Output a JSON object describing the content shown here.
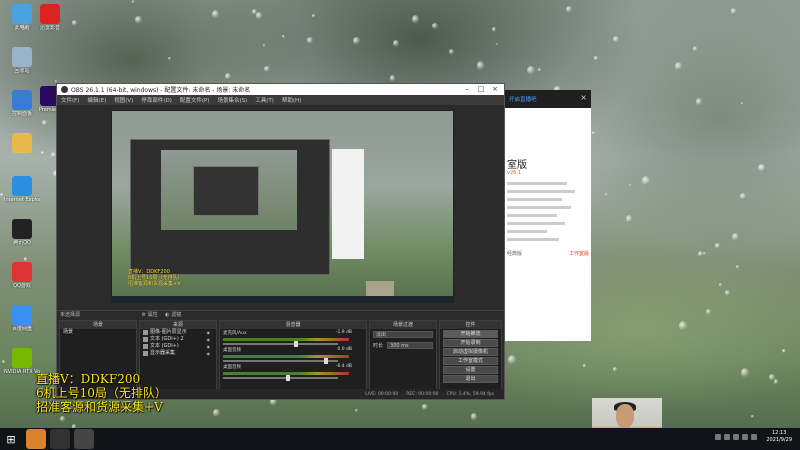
{
  "desktop": {
    "icons": [
      {
        "label": "此电脑",
        "icon": "computer-icon",
        "color": "#4aa3e0"
      },
      {
        "label": "回收站",
        "icon": "recycle-bin-icon",
        "color": "#9bb3c9"
      },
      {
        "label": "控制面板",
        "icon": "control-panel-icon",
        "color": "#3a7bd5"
      },
      {
        "label": "",
        "icon": "folder-icon",
        "color": "#e9b949"
      },
      {
        "label": "Internet Explorer",
        "icon": "ie-icon",
        "color": "#2d8ee0"
      },
      {
        "label": "腾讯QQ",
        "icon": "qq-icon",
        "color": "#222222"
      },
      {
        "label": "QQ游戏",
        "icon": "qq-games-icon",
        "color": "#d33"
      },
      {
        "label": "百度网盘",
        "icon": "baidu-netdisk-icon",
        "color": "#3b8ff3"
      },
      {
        "label": "NVIDIA RTX Voice",
        "icon": "nvidia-rtx-voice-icon",
        "color": "#76b900"
      }
    ],
    "second_column": [
      {
        "label": "迅雷影音",
        "icon": "red-logo-icon",
        "color": "#d22"
      },
      {
        "label": "Premiere",
        "icon": "premiere-icon",
        "color": "#2a0a5e"
      }
    ]
  },
  "obs": {
    "title": "OBS 26.1.1 (64-bit, windows) - 配置文件: 未命名 - 场景: 未命名",
    "menu": [
      "文件(F)",
      "编辑(E)",
      "视图(V)",
      "停靠部件(D)",
      "配置文件(P)",
      "场景集合(S)",
      "工具(T)",
      "帮助(H)"
    ],
    "source_toolbar": "未选择源",
    "source_props": "属性",
    "source_filters": "滤镜",
    "docks": {
      "scenes": {
        "title": "场景",
        "items": [
          "场景"
        ]
      },
      "sources": {
        "title": "来源",
        "items": [
          "图像-图片层显示",
          "文本 (GDI+) 2",
          "文本 (GDI+)",
          "显示器采集"
        ]
      },
      "mixer": {
        "title": "混音器",
        "tracks": [
          {
            "name": "麦克风/Aux",
            "db": "-1.9 dB",
            "level": 0.62
          },
          {
            "name": "桌面音频",
            "db": "0.0 dB",
            "level": 0.88
          },
          {
            "name": "桌面音频",
            "db": "-6.4 dB",
            "level": 0.55
          }
        ]
      },
      "transitions": {
        "title": "场景过渡",
        "type": "淡出",
        "duration_label": "时长",
        "duration": "300 ms"
      },
      "controls": {
        "title": "控件",
        "buttons": [
          "开始推流",
          "开始录制",
          "启动虚拟摄像机",
          "工作室模式",
          "设置",
          "退出"
        ]
      }
    },
    "status": {
      "live": "LIVE: 00:00:00",
      "rec": "REC: 00:00:00",
      "cpu": "CPU: 1.4%, 59.94 fps"
    }
  },
  "popup": {
    "link": "开启直播吧",
    "title": "室版",
    "version": "v26.1",
    "foot_left": "经典版",
    "foot_right": "工作室版"
  },
  "preview_overlay": [
    "直播V：DDKF200",
    "6机上号10局（无排队）",
    "招准客源和货源采集+V"
  ],
  "caption": [
    "直播V：DDKF200",
    "6机上号10局（无排队）",
    "招准客源和货源采集+V"
  ],
  "taskbar": {
    "apps": [
      {
        "icon": "start-icon",
        "color": "#101418"
      },
      {
        "icon": "orange-app-icon",
        "color": "#d9822b"
      },
      {
        "icon": "qq-taskbar-icon",
        "color": "#333"
      },
      {
        "icon": "obs-taskbar-icon",
        "color": "#444"
      }
    ],
    "time": "12:13",
    "date": "2021/9/29"
  }
}
